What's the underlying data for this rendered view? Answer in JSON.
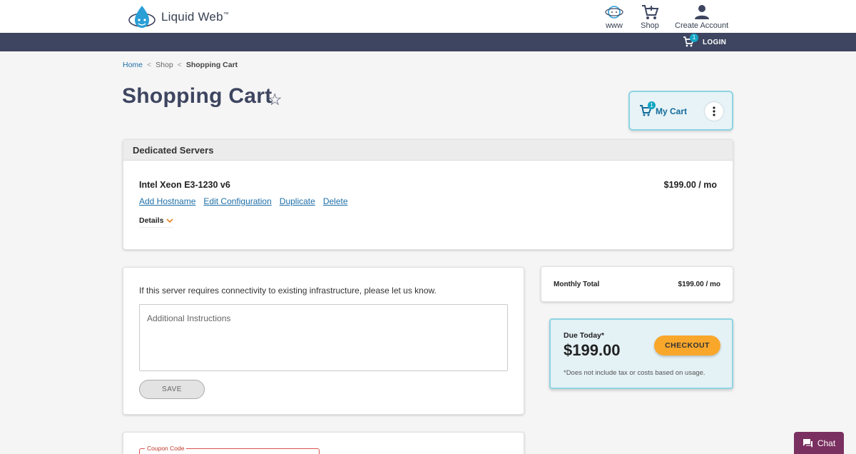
{
  "header": {
    "brand": "Liquid Web",
    "brand_mark": "™",
    "nav": {
      "www": "www",
      "shop": "Shop",
      "account": "Create Account"
    },
    "cart_count": "1",
    "login": "LOGIN"
  },
  "breadcrumb": {
    "home": "Home",
    "sep1": "<",
    "shop": "Shop",
    "sep2": "<",
    "current": "Shopping Cart"
  },
  "page": {
    "title": "Shopping Cart"
  },
  "mycart": {
    "label": "My Cart",
    "count": "1"
  },
  "servers": {
    "heading": "Dedicated Servers",
    "item": {
      "name": "Intel Xeon E3-1230 v6",
      "price": "$199.00 / mo",
      "links": {
        "add_hostname": "Add Hostname",
        "edit": "Edit Configuration",
        "duplicate": "Duplicate",
        "delete": "Delete"
      },
      "details": "Details"
    }
  },
  "instructions": {
    "message": "If this server requires connectivity to existing infrastructure, please let us know.",
    "placeholder": "Additional Instructions",
    "value": "",
    "save": "SAVE"
  },
  "totals": {
    "monthly_label": "Monthly Total",
    "monthly_value": "$199.00 / mo",
    "due_label": "Due Today*",
    "due_value": "$199.00",
    "checkout": "CHECKOUT",
    "note": "*Does not include tax or costs based on usage."
  },
  "coupon": {
    "label": "Coupon Code",
    "value": ""
  },
  "chat": {
    "label": "Chat"
  },
  "colors": {
    "brand_navy": "#3d4560",
    "link": "#1e6fa8",
    "accent_cyan": "#13a6c4",
    "checkout": "#f9a72b",
    "chat": "#7a3060"
  },
  "icons": [
    "liquid-web-logo",
    "globe-icon",
    "shop-cart-icon",
    "account-icon",
    "cart-icon",
    "star-icon",
    "kebab-icon",
    "chevron-down-icon",
    "chat-icon"
  ]
}
